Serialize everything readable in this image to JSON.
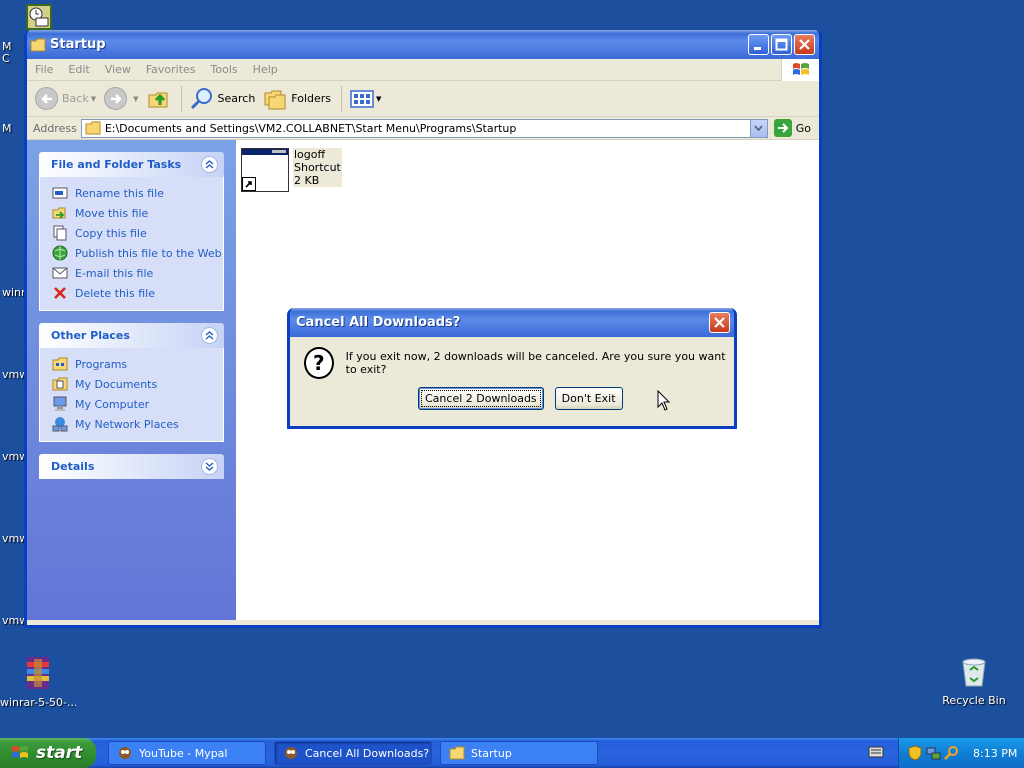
{
  "desktop": {
    "icons": [
      {
        "label": "winrar-5-50-..."
      },
      {
        "label": "Recycle Bin"
      }
    ],
    "fragments": [
      "M",
      "C",
      "M",
      "winr",
      "vmw",
      "vmw",
      "vmw",
      "vmw"
    ]
  },
  "explorer": {
    "title": "Startup",
    "menu": [
      "File",
      "Edit",
      "View",
      "Favorites",
      "Tools",
      "Help"
    ],
    "toolbar": {
      "back_label": "Back",
      "search_label": "Search",
      "folders_label": "Folders"
    },
    "address": {
      "label": "Address",
      "path": "E:\\Documents and Settings\\VM2.COLLABNET\\Start Menu\\Programs\\Startup",
      "go_label": "Go"
    },
    "taskpane": {
      "file_tasks": {
        "title": "File and Folder Tasks",
        "items": [
          {
            "label": "Rename this file",
            "icon": "rename-icon"
          },
          {
            "label": "Move this file",
            "icon": "move-icon"
          },
          {
            "label": "Copy this file",
            "icon": "copy-icon"
          },
          {
            "label": "Publish this file to the Web",
            "icon": "publish-web-icon"
          },
          {
            "label": "E-mail this file",
            "icon": "email-icon"
          },
          {
            "label": "Delete this file",
            "icon": "delete-icon"
          }
        ]
      },
      "other_places": {
        "title": "Other Places",
        "items": [
          {
            "label": "Programs",
            "icon": "programs-folder-icon"
          },
          {
            "label": "My Documents",
            "icon": "my-documents-icon"
          },
          {
            "label": "My Computer",
            "icon": "my-computer-icon"
          },
          {
            "label": "My Network Places",
            "icon": "network-places-icon"
          }
        ]
      },
      "details": {
        "title": "Details"
      }
    },
    "file": {
      "name": "logoff",
      "type": "Shortcut",
      "size": "2 KB"
    }
  },
  "dialog": {
    "title": "Cancel All Downloads?",
    "message": "If you exit now, 2 downloads will be canceled. Are you sure you want to exit?",
    "primary_label": "Cancel 2 Downloads",
    "secondary_label": "Don't Exit"
  },
  "taskbar": {
    "start_label": "start",
    "tasks": [
      {
        "label": "YouTube - Mypal"
      },
      {
        "label": "Cancel All Downloads?"
      },
      {
        "label": "Startup"
      }
    ],
    "clock": "8:13 PM"
  },
  "colors": {
    "desktop_bg": "#1d4f9f",
    "titlebar": "#3d6fd8",
    "link_blue": "#215dc6"
  }
}
